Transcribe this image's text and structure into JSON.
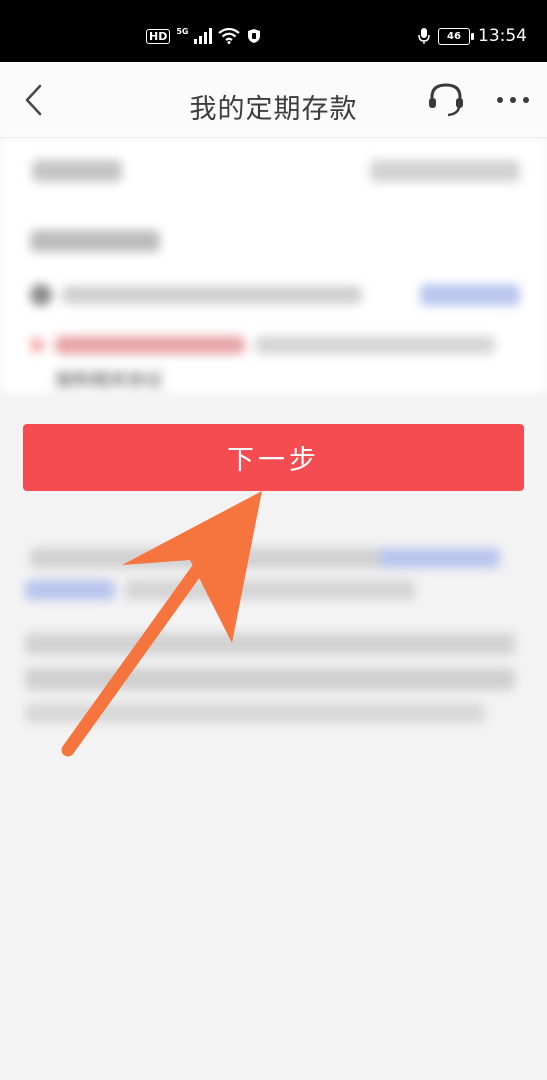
{
  "status_bar": {
    "hd_label": "HD",
    "network_label": "5G",
    "battery_level": "46",
    "time": "13:54"
  },
  "header": {
    "title": "我的定期存款"
  },
  "blurred_content": {
    "partial_text": "接和相关协议"
  },
  "next_button": {
    "label": "下一步"
  },
  "colors": {
    "button_red": "#f44c51",
    "arrow_orange": "#f6743d",
    "background": "#f3f3f4"
  },
  "icons": [
    "back-arrow-icon",
    "headset-icon",
    "more-icon",
    "wifi-icon",
    "signal-icon",
    "mic-icon",
    "battery-icon"
  ]
}
